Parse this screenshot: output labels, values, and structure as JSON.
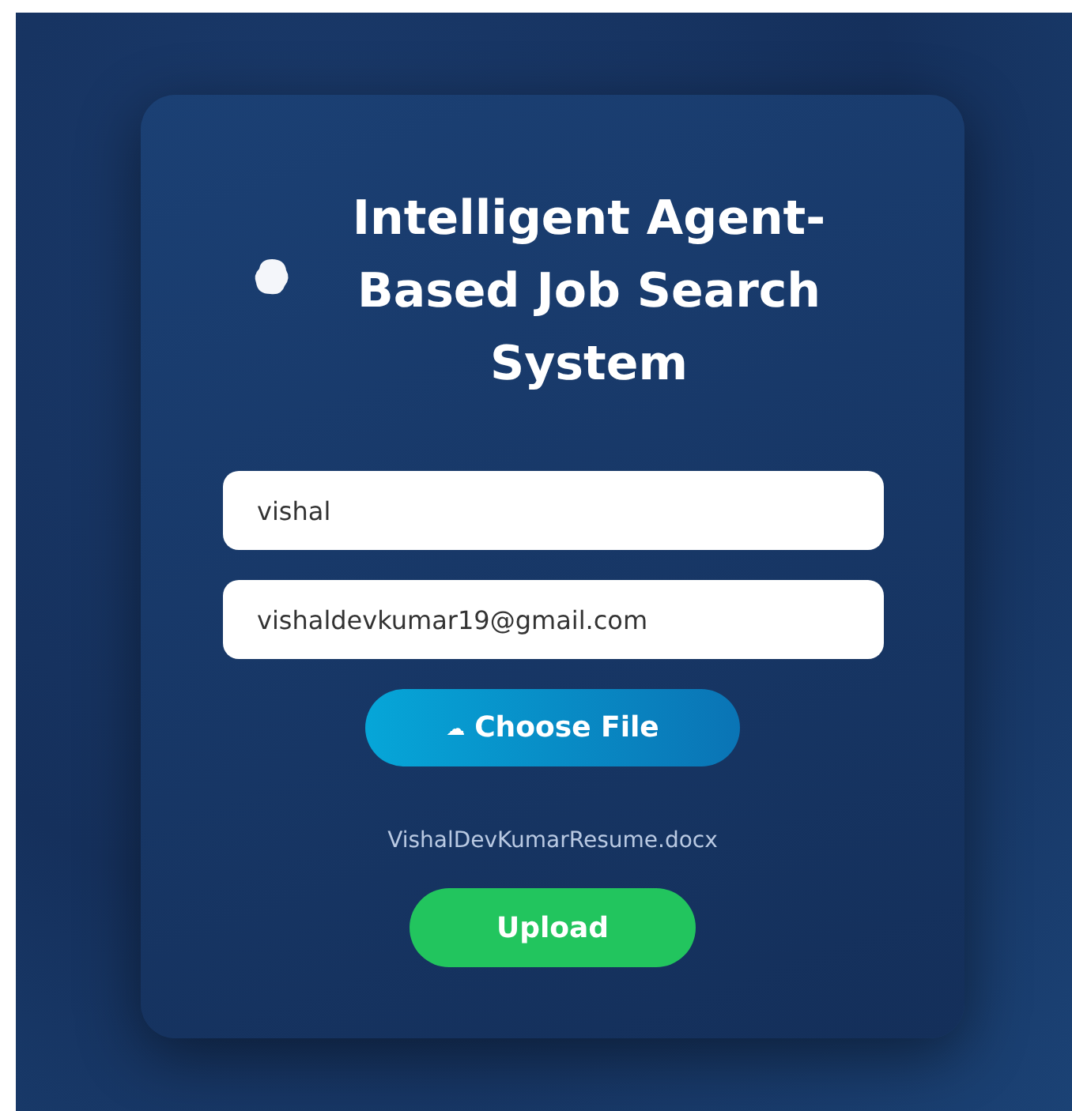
{
  "title": "Intelligent Agent-Based Job Search System",
  "fields": [
    {
      "value": "vishal"
    },
    {
      "value": "vishaldevkumar19@gmail.com"
    }
  ],
  "choose_file_button": {
    "icon": "☁",
    "label": "Choose File"
  },
  "file_name": "VishalDevKumarResume.docx",
  "upload_button": {
    "label": "Upload"
  }
}
